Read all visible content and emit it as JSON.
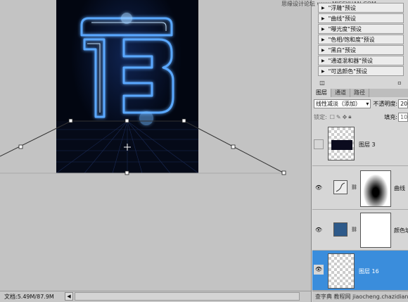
{
  "status": {
    "doc_info": "文档:5.49M/87.9M"
  },
  "watermark": "思缘设计论坛 www.MISSYUAN.COM",
  "actions": [
    {
      "label": "\"浮雕\"预设"
    },
    {
      "label": "\"曲线\"预设"
    },
    {
      "label": "\"曝光度\"预设"
    },
    {
      "label": "\"色相/饱和度\"预设"
    },
    {
      "label": "\"黑白\"预设"
    },
    {
      "label": "\"通道混和器\"预设"
    },
    {
      "label": "\"可选颜色\"预设"
    }
  ],
  "panel_tabs": [
    "图层",
    "通道",
    "路径"
  ],
  "blend": {
    "mode": "线性减淡（添加）",
    "opacity_label": "不透明度:",
    "opacity_value": "20",
    "fill_label": "填充:",
    "fill_value": "100"
  },
  "lock_label": "锁定:",
  "layers": [
    {
      "name": "图层 3",
      "visible": false
    },
    {
      "name": "曲线",
      "visible": true
    },
    {
      "name": "颜色填",
      "visible": true
    },
    {
      "name": "图层 16",
      "visible": true,
      "selected": true
    }
  ],
  "bottom_watermark": "查字典 教程网 jiaocheng.chazidian.com",
  "colors": {
    "selection": "#3a8ddc",
    "neon": "#5aa8ff"
  }
}
